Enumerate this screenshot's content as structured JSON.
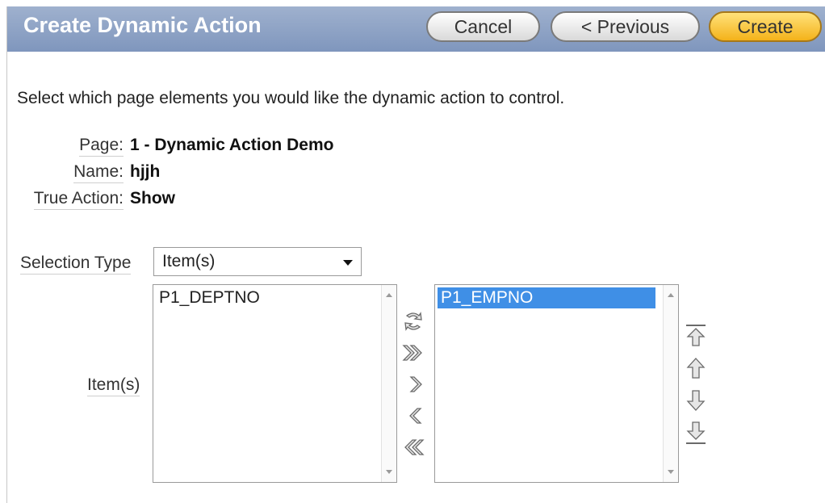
{
  "header": {
    "title": "Create Dynamic Action",
    "buttons": {
      "cancel": "Cancel",
      "previous": "< Previous",
      "create": "Create"
    }
  },
  "intro": "Select which page elements you would like the dynamic action to control.",
  "info": {
    "page_label": "Page:",
    "page_value": "1 - Dynamic Action Demo",
    "name_label": "Name:",
    "name_value": "hjjh",
    "true_action_label": "True Action:",
    "true_action_value": "Show"
  },
  "selection_type": {
    "label": "Selection Type",
    "value": "Item(s)"
  },
  "items": {
    "label": "Item(s)",
    "available": [
      "P1_DEPTNO"
    ],
    "selected": [
      "P1_EMPNO"
    ]
  },
  "icons": {
    "shuttle": [
      "reset-icon",
      "move-all-icon",
      "move-icon",
      "remove-icon",
      "remove-all-icon"
    ],
    "order": [
      "move-top-icon",
      "move-up-icon",
      "move-down-icon",
      "move-bottom-icon"
    ]
  },
  "colors": {
    "header_bg": "#8ea3c5",
    "create_button": "#f6bd2a",
    "selected_option": "#3f8fe6"
  }
}
